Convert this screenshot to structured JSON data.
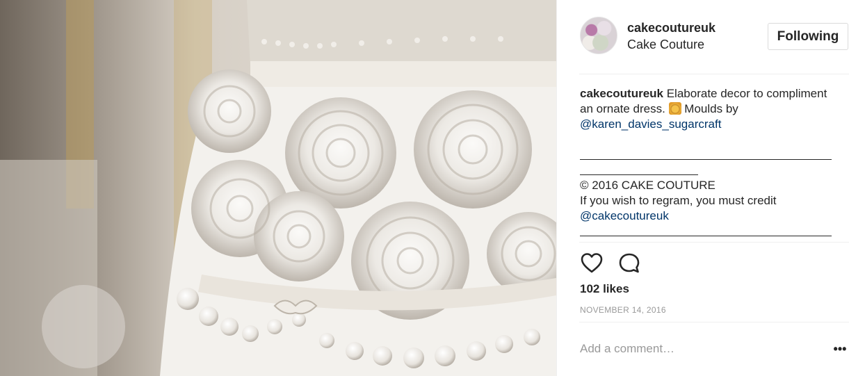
{
  "post": {
    "image_alt": "Close-up of an ornate white wedding cake decorated with sugar roses and pearls"
  },
  "header": {
    "username": "cakecoutureuk",
    "location": "Cake Couture",
    "follow_label": "Following"
  },
  "caption": {
    "username": "cakecoutureuk",
    "text_1": " Elaborate decor to compliment an ornate dress. ",
    "text_2": " Moulds by ",
    "mention": "@karen_davies_sugarcraft",
    "copyright": "© 2016 CAKE COUTURE",
    "regram_note": "If you wish to regram, you must credit",
    "credit_handle": "@cakecoutureuk"
  },
  "stats": {
    "likes": "102 likes",
    "date": "NOVEMBER 14, 2016"
  },
  "comment": {
    "placeholder": "Add a comment…",
    "more_label": "•••"
  },
  "icons": {
    "like": "heart-icon",
    "comment": "comment-bubble-icon",
    "more": "more-options-icon",
    "emoji": "bride-emoji-icon"
  }
}
